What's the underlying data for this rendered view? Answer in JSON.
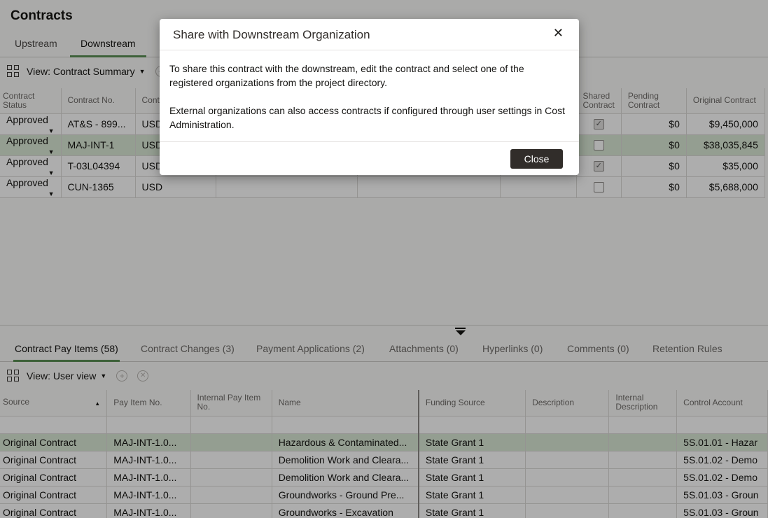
{
  "page": {
    "title": "Contracts"
  },
  "top_tabs": [
    "Upstream",
    "Downstream"
  ],
  "toolbar": {
    "view_label": "View: Contract Summary"
  },
  "contracts_table": {
    "headers": {
      "status": "Contract Status",
      "number": "Contract No.",
      "currency": "Cont Curr",
      "shared": "Shared Contract",
      "pending": "Pending Contract",
      "original": "Original Contract"
    },
    "rows": [
      {
        "status": "Approved",
        "number": "AT&S - 899...",
        "currency": "USD",
        "pending": "$0",
        "original": "$9,450,000"
      },
      {
        "status": "Approved",
        "number": "MAJ-INT-1",
        "currency": "USD",
        "pending": "$0",
        "original": "$38,035,845"
      },
      {
        "status": "Approved",
        "number": "T-03L04394",
        "currency": "USD",
        "pending": "$0",
        "original": "$35,000"
      },
      {
        "status": "Approved",
        "number": "CUN-1365",
        "currency": "USD",
        "pending": "$0",
        "original": "$5,688,000"
      }
    ]
  },
  "bottom_tabs": [
    "Contract Pay Items (58)",
    "Contract Changes (3)",
    "Payment Applications (2)",
    "Attachments (0)",
    "Hyperlinks (0)",
    "Comments (0)",
    "Retention Rules"
  ],
  "bottom_toolbar": {
    "view_label": "View: User view"
  },
  "pay_items_table": {
    "headers": {
      "source": "Source",
      "pay_item": "Pay Item No.",
      "internal_pay_item": "Internal Pay Item No.",
      "name": "Name",
      "funding": "Funding Source",
      "description": "Description",
      "internal_description": "Internal Description",
      "control_account": "Control Account"
    },
    "rows": [
      {
        "source": "Original Contract",
        "pay_item": "MAJ-INT-1.0...",
        "name": "Hazardous & Contaminated...",
        "funding": "State Grant 1",
        "control_account": "5S.01.01 - Hazar"
      },
      {
        "source": "Original Contract",
        "pay_item": "MAJ-INT-1.0...",
        "name": "Demolition Work and Cleara...",
        "funding": "State Grant 1",
        "control_account": "5S.01.02 - Demo"
      },
      {
        "source": "Original Contract",
        "pay_item": "MAJ-INT-1.0...",
        "name": "Demolition Work and Cleara...",
        "funding": "State Grant 1",
        "control_account": "5S.01.02 - Demo"
      },
      {
        "source": "Original Contract",
        "pay_item": "MAJ-INT-1.0...",
        "name": "Groundworks - Ground Pre...",
        "funding": "State Grant 1",
        "control_account": "5S.01.03 - Groun"
      },
      {
        "source": "Original Contract",
        "pay_item": "MAJ-INT-1.0...",
        "name": "Groundworks - Excavation",
        "funding": "State Grant 1",
        "control_account": "5S.01.03 - Groun"
      }
    ]
  },
  "dialog": {
    "title": "Share with Downstream Organization",
    "paragraph_1": "To share this contract with the downstream, edit the contract and select one of the registered organizations from the project directory.",
    "paragraph_2": "External organizations can also access contracts if configured through user settings in Cost Administration.",
    "close_label": "Close"
  },
  "colors": {
    "accent": "#5a8f54",
    "selected_row": "#dbe9d6",
    "primary_button": "#312d2a"
  }
}
